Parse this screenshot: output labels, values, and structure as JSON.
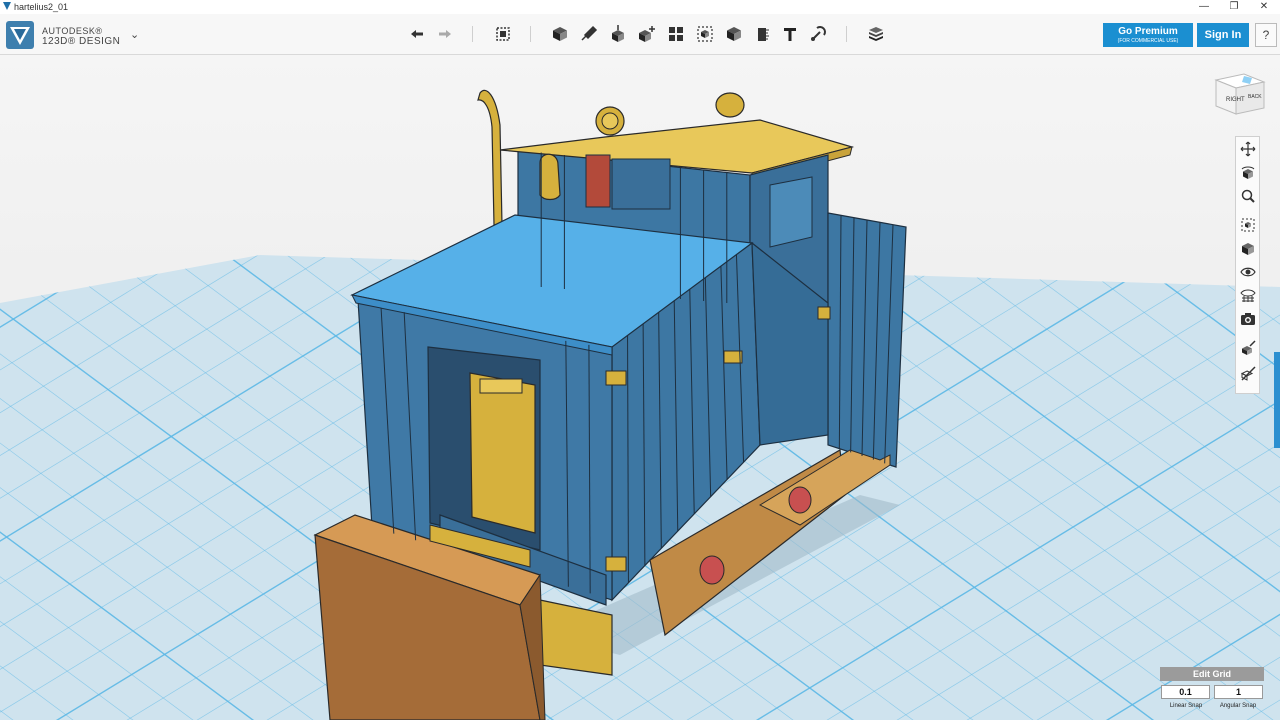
{
  "window": {
    "title": "hartelius2_01",
    "controls": [
      "—",
      "❐",
      "✕"
    ]
  },
  "app": {
    "brand_line1": "AUTODESK®",
    "brand_line2": "123D® DESIGN",
    "menu_icon": "chevron-down-icon"
  },
  "toolbar": {
    "groups": [
      [
        "undo-icon",
        "redo-icon"
      ],
      [
        "transform-icon"
      ],
      [
        "primitives-icon",
        "sketch-icon",
        "construct-icon",
        "modify-icon",
        "pattern-icon",
        "grouping-icon",
        "combine-icon",
        "measure-icon",
        "text-icon",
        "snap-icon"
      ],
      [
        "material-icon"
      ]
    ]
  },
  "account": {
    "premium_label": "Go Premium",
    "premium_sub": "(FOR COMMERCIAL USE)",
    "signin_label": "Sign In",
    "help_label": "?"
  },
  "viewcube": {
    "face_right": "RIGHT",
    "face_back": "BACK"
  },
  "nav_tools": [
    "pan-icon",
    "orbit-icon",
    "zoom-icon",
    "fit-icon",
    "views-icon",
    "visibility-icon",
    "materials-view-icon",
    "screenshot-icon",
    "outline-icon",
    "hide-icon"
  ],
  "grid": {
    "edit_label": "Edit Grid",
    "linear_value": "0.1",
    "angular_value": "1",
    "linear_label": "Linear Snap",
    "angular_label": "Angular Snap"
  },
  "colors": {
    "accent": "#1b8fd1",
    "grid_bg": "#cfe3ee",
    "grid_line": "#5cb8e6",
    "model_blue": "#3d77a3",
    "roof_blue": "#56b0e8",
    "model_gold": "#d6b13d",
    "model_orange": "#c08a46",
    "model_red": "#c85050"
  }
}
